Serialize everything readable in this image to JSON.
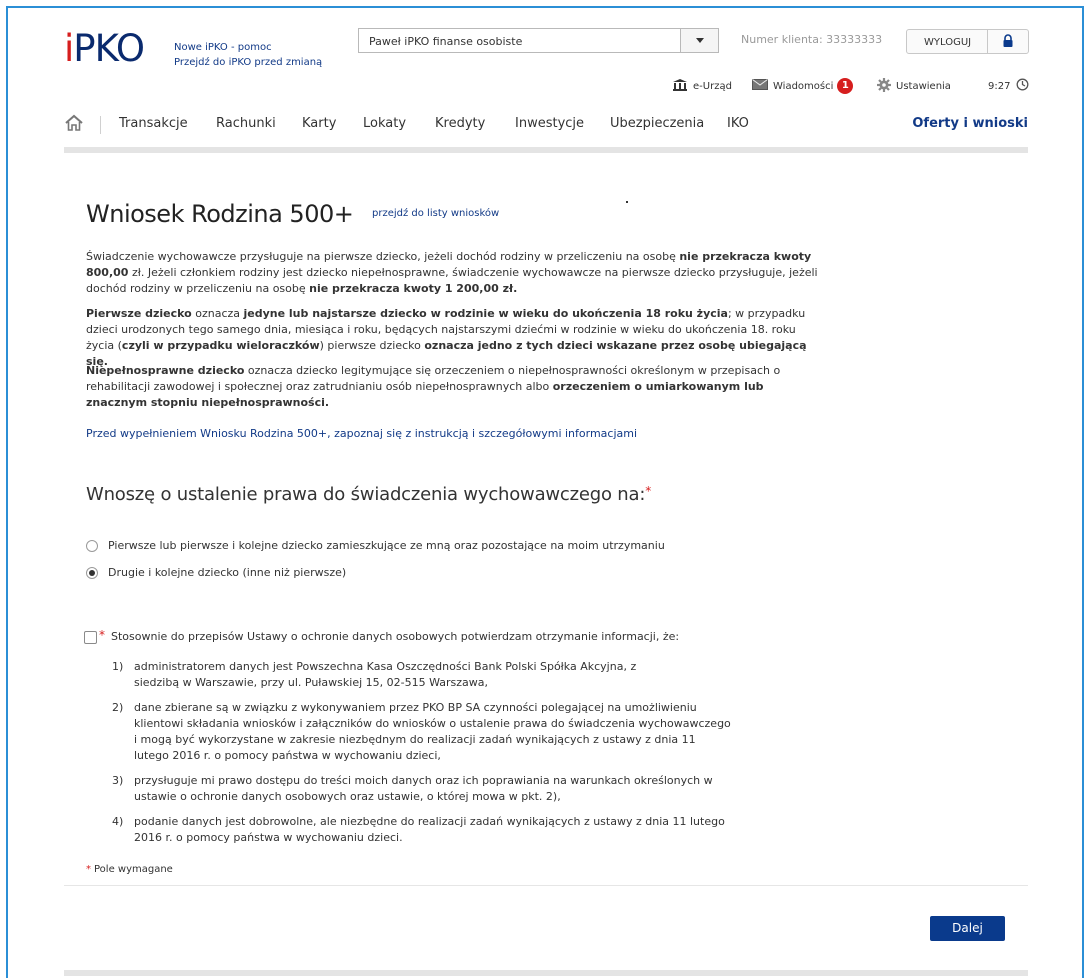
{
  "header": {
    "logo": "PKO",
    "help_link": "Nowe iPKO - pomoc",
    "old_link": "Przejdź do iPKO przed zmianą",
    "account_select": "Paweł iPKO finanse osobiste",
    "client_number": "Numer klienta: 33333333",
    "logout": "WYLOGUJ",
    "eurzad": "e-Urząd",
    "messages": "Wiadomości",
    "messages_count": "1",
    "settings": "Ustawienia",
    "time": "9:27"
  },
  "nav": {
    "items": [
      "Transakcje",
      "Rachunki",
      "Karty",
      "Lokaty",
      "Kredyty",
      "Inwestycje",
      "Ubezpieczenia",
      "IKO"
    ],
    "offers": "Oferty i wnioski"
  },
  "page": {
    "title": "Wniosek Rodzina 500+",
    "title_link": "przejdź do listy wniosków",
    "p1_a": "Świadczenie wychowawcze przysługuje na pierwsze dziecko, jeżeli dochód rodziny w przeliczeniu na osobę ",
    "p1_b": "nie przekracza kwoty 800,00",
    "p1_c": " zł. Jeżeli członkiem rodziny jest dziecko niepełnosprawne, świadczenie wychowawcze na pierwsze dziecko przysługuje, jeżeli dochód rodziny w przeliczeniu na osobę ",
    "p1_d": "nie przekracza kwoty 1 200,00 zł.",
    "p2_a": "Pierwsze dziecko",
    "p2_b": " oznacza ",
    "p2_c": "jedyne lub najstarsze dziecko w rodzinie w wieku do ukończenia 18 roku życia",
    "p2_d": "; w przypadku dzieci urodzonych tego samego dnia, miesiąca i roku, będących najstarszymi dziećmi w rodzinie w wieku do ukończenia 18. roku życia (",
    "p2_e": "czyli w przypadku wieloraczków",
    "p2_f": ") pierwsze dziecko ",
    "p2_g": "oznacza jedno z tych dzieci wskazane przez osobę ubiegającą się.",
    "p3_a": "Niepełnosprawne dziecko",
    "p3_b": " oznacza dziecko legitymujące się orzeczeniem o niepełnosprawności określonym w przepisach o rehabilitacji zawodowej i społecznej oraz zatrudnianiu osób niepełnosprawnych albo ",
    "p3_c": "orzeczeniem o umiarkowanym lub znacznym stopniu niepełnosprawności.",
    "info_link": "Przed wypełnieniem Wniosku Rodzina 500+, zapoznaj się z instrukcją i szczegółowymi informacjami",
    "question": "Wnoszę o ustalenie prawa do świadczenia wychowawczego na:",
    "required_mark": "*",
    "radio_options": [
      {
        "label": "Pierwsze lub pierwsze i kolejne dziecko zamieszkujące ze mną oraz pozostające na moim utrzymaniu",
        "selected": false
      },
      {
        "label": "Drugie i kolejne dziecko (inne niż pierwsze)",
        "selected": true
      }
    ],
    "consent_text": "Stosownie do przepisów Ustawy o ochronie danych osobowych potwierdzam otrzymanie informacji, że:",
    "consent_checked": false,
    "consent_items": [
      {
        "num": "1)",
        "text": "administratorem danych jest Powszechna Kasa Oszczędności Bank Polski Spółka Akcyjna, z siedzibą w Warszawie, przy ul. Puławskiej 15, 02-515 Warszawa,"
      },
      {
        "num": "2)",
        "text": "dane zbierane są w związku z wykonywaniem przez PKO BP SA czynności polegającej na umożliwieniu klientowi składania wniosków i załączników do wniosków o ustalenie prawa do świadczenia wychowawczego i mogą być wykorzystane w zakresie niezbędnym do realizacji zadań wynikających z ustawy z dnia 11 lutego 2016 r. o pomocy państwa w wychowaniu dzieci,"
      },
      {
        "num": "3)",
        "text": "przysługuje mi prawo dostępu do treści moich danych oraz ich poprawiania na warunkach określonych w ustawie o ochronie danych osobowych oraz ustawie, o której mowa w pkt. 2),"
      },
      {
        "num": "4)",
        "text": "podanie danych jest dobrowolne, ale niezbędne do  realizacji zadań wynikających z ustawy z dnia 11 lutego 2016 r. o pomocy państwa w wychowaniu dzieci."
      }
    ],
    "required_note": "Pole wymagane",
    "next_button": "Dalej"
  }
}
